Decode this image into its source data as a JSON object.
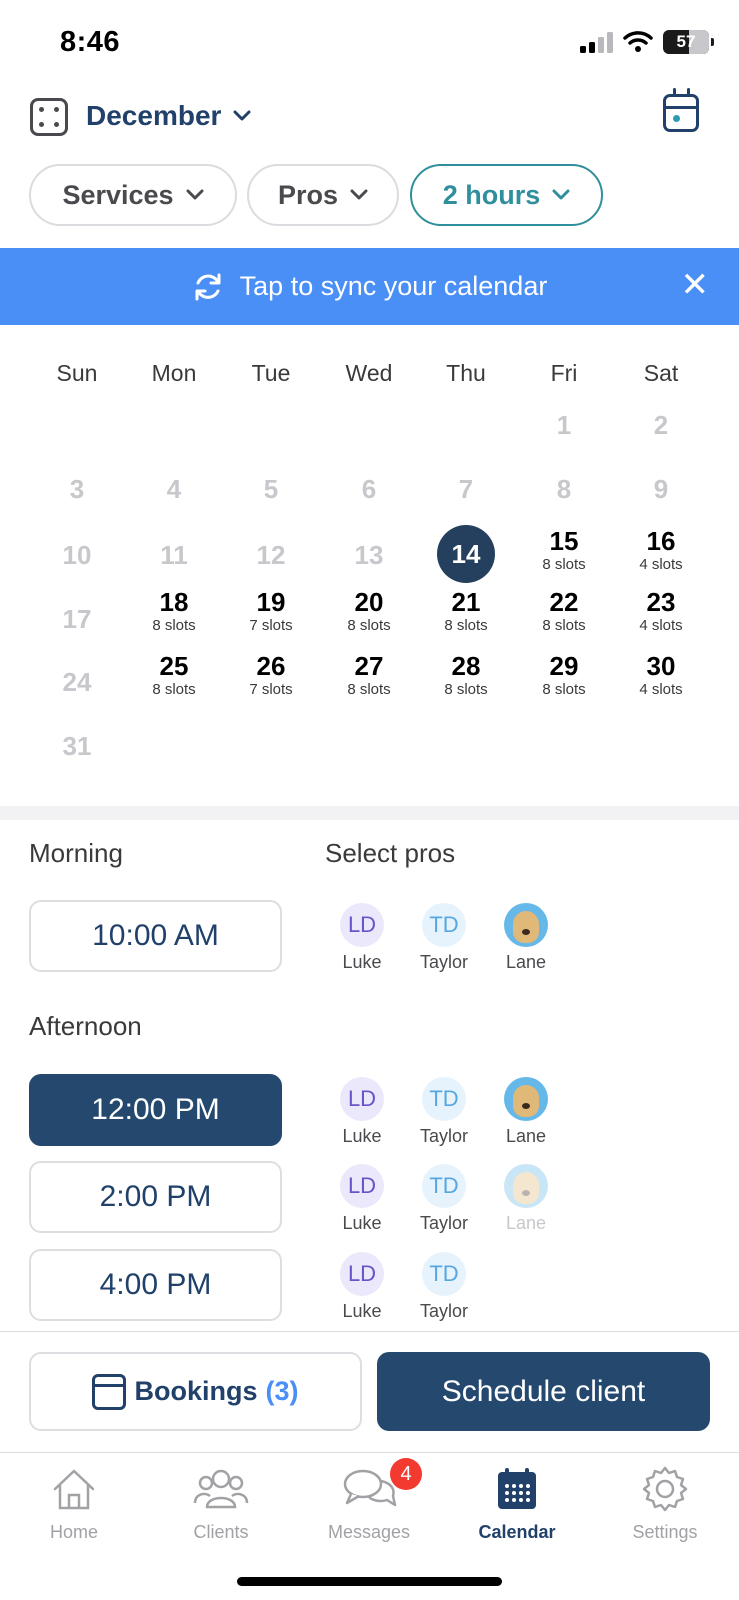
{
  "status_bar": {
    "time": "8:46",
    "battery": "57",
    "battery_level": 0.57
  },
  "header": {
    "month": "December",
    "filters": [
      {
        "label": "Services",
        "active": false
      },
      {
        "label": "Pros",
        "active": false
      },
      {
        "label": "2 hours",
        "active": true
      }
    ]
  },
  "banner": {
    "text": "Tap to sync your calendar"
  },
  "calendar": {
    "weekdays": [
      "Sun",
      "Mon",
      "Tue",
      "Wed",
      "Thu",
      "Fri",
      "Sat"
    ],
    "selected_day": "14",
    "weeks": [
      [
        null,
        null,
        null,
        null,
        null,
        {
          "d": "1"
        },
        {
          "d": "2"
        }
      ],
      [
        {
          "d": "3"
        },
        {
          "d": "4"
        },
        {
          "d": "5"
        },
        {
          "d": "6"
        },
        {
          "d": "7"
        },
        {
          "d": "8"
        },
        {
          "d": "9"
        }
      ],
      [
        {
          "d": "10"
        },
        {
          "d": "11"
        },
        {
          "d": "12"
        },
        {
          "d": "13"
        },
        {
          "d": "14",
          "sel": true
        },
        {
          "d": "15",
          "s": "8 slots"
        },
        {
          "d": "16",
          "s": "4 slots"
        }
      ],
      [
        {
          "d": "17"
        },
        {
          "d": "18",
          "s": "8 slots"
        },
        {
          "d": "19",
          "s": "7 slots"
        },
        {
          "d": "20",
          "s": "8 slots"
        },
        {
          "d": "21",
          "s": "8 slots"
        },
        {
          "d": "22",
          "s": "8 slots"
        },
        {
          "d": "23",
          "s": "4 slots"
        }
      ],
      [
        {
          "d": "24"
        },
        {
          "d": "25",
          "s": "8 slots"
        },
        {
          "d": "26",
          "s": "7 slots"
        },
        {
          "d": "27",
          "s": "8 slots"
        },
        {
          "d": "28",
          "s": "8 slots"
        },
        {
          "d": "29",
          "s": "8 slots"
        },
        {
          "d": "30",
          "s": "4 slots"
        }
      ],
      [
        {
          "d": "31"
        },
        null,
        null,
        null,
        null,
        null,
        null
      ]
    ]
  },
  "sections": {
    "morning": "Morning",
    "afternoon": "Afternoon",
    "select_pros": "Select pros"
  },
  "slots": [
    {
      "time": "10:00 AM",
      "selected": false,
      "pros": [
        "Luke",
        "Taylor",
        "Lane"
      ],
      "unavailable": []
    },
    {
      "time": "12:00 PM",
      "selected": true,
      "pros": [
        "Luke",
        "Taylor",
        "Lane"
      ],
      "unavailable": []
    },
    {
      "time": "2:00 PM",
      "selected": false,
      "pros": [
        "Luke",
        "Taylor",
        "Lane"
      ],
      "unavailable": [
        "Lane"
      ]
    },
    {
      "time": "4:00 PM",
      "selected": false,
      "pros": [
        "Luke",
        "Taylor"
      ],
      "unavailable": []
    }
  ],
  "pros": {
    "Luke": {
      "initials": "LD",
      "kind": "ld"
    },
    "Taylor": {
      "initials": "TD",
      "kind": "td"
    },
    "Lane": {
      "initials": "",
      "kind": "dog"
    }
  },
  "actions": {
    "bookings_label": "Bookings",
    "bookings_count": "(3)",
    "schedule_label": "Schedule client"
  },
  "tabbar": {
    "tabs": [
      {
        "label": "Home",
        "icon": "home-icon"
      },
      {
        "label": "Clients",
        "icon": "clients-icon"
      },
      {
        "label": "Messages",
        "icon": "messages-icon"
      },
      {
        "label": "Calendar",
        "icon": "calendar-icon",
        "active": true
      },
      {
        "label": "Settings",
        "icon": "gear-icon"
      }
    ],
    "messages_badge": "4"
  },
  "colors": {
    "primary": "#25496e",
    "accent": "#4a8ff5",
    "teal": "#2f8f9d",
    "badge": "#f23a30"
  }
}
